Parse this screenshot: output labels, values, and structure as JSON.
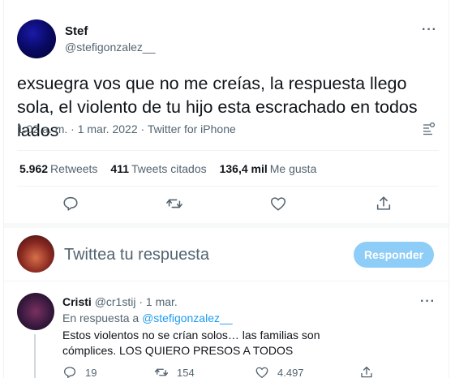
{
  "tweet": {
    "author_name": "Stef",
    "author_handle": "@stefigonzalez__",
    "more_label": "···",
    "text": "exsuegra vos que no me creías, la respuesta llego sola, el violento de tu hijo esta escrachado en todos lados",
    "meta": "1:02 a. m. · 1 mar. 2022 · Twitter for iPhone",
    "stats": {
      "retweets_count": "5.962",
      "retweets_label": "Retweets",
      "quotes_count": "411",
      "quotes_label": "Tweets citados",
      "likes_count": "136,4 mil",
      "likes_label": "Me gusta"
    },
    "icons": [
      "reply-icon",
      "retweet-icon",
      "like-icon",
      "share-icon",
      "analytics-icon",
      "more-icon"
    ]
  },
  "composer": {
    "placeholder": "Twittea tu respuesta",
    "button_label": "Responder"
  },
  "reply": {
    "author_name": "Cristi",
    "author_handle": "@cr1stij",
    "date": "· 1 mar.",
    "more_label": "···",
    "replying_prefix": "En respuesta a",
    "replying_to": "@stefigonzalez__",
    "text": "Estos violentos no se crían solos… las familias son cómplices. LOS QUIERO PRESOS A TODOS",
    "reply_count": "19",
    "retweet_count": "154",
    "like_count": "4.497"
  },
  "colors": {
    "accent": "#1d9bf0",
    "button_disabled": "#8ecdf8",
    "secondary_text": "#536471",
    "divider": "#eff3f4"
  }
}
